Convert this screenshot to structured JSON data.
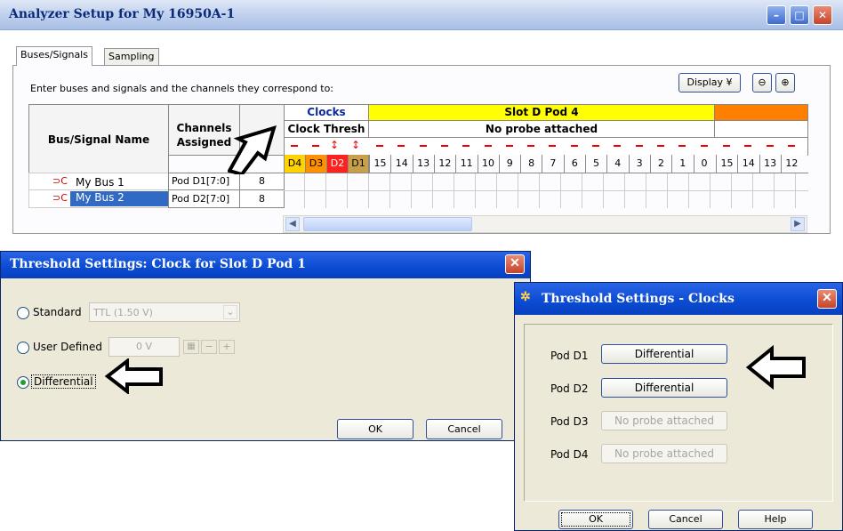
{
  "main_window": {
    "title": "Analyzer Setup for My 16950A-1",
    "tabs": [
      {
        "label": "Buses/Signals",
        "active": true
      },
      {
        "label": "Sampling",
        "active": false
      }
    ],
    "instruction": "Enter buses and signals and the channels they correspond to:",
    "display_button": "Display",
    "zoom_out_icon": "zoom-out-icon",
    "zoom_in_icon": "zoom-in-icon",
    "headers": {
      "bus_signal_name": "Bus/Signal Name",
      "channels_assigned": "Channels Assigned",
      "clocks": "Clocks",
      "clock_thresh": "Clock Thresh",
      "slot_pod": "Slot D Pod 4",
      "no_probe": "No probe attached"
    },
    "clock_channels": [
      "D4",
      "D3",
      "D2",
      "D1"
    ],
    "pod4_channels": [
      "15",
      "14",
      "13",
      "12",
      "11",
      "10",
      "9",
      "8",
      "7",
      "6",
      "5",
      "4",
      "3",
      "2",
      "1",
      "0"
    ],
    "next_pod_channels": [
      "15",
      "14",
      "13",
      "12"
    ],
    "rows": [
      {
        "name": "My Bus 1",
        "channels": "Pod D1[7:0]",
        "width": "8"
      },
      {
        "name": "My Bus 2",
        "channels": "Pod D2[7:0]",
        "width": "8"
      }
    ],
    "colors": {
      "clocks_header": "#0b2aa0",
      "slot_yellow": "#ffff00",
      "slot_orange": "#ff7f00",
      "d4": "#ffd200",
      "d3": "#ff9000",
      "d2": "#ff2020",
      "d1": "#c8a04a"
    }
  },
  "threshold_dialog_pod1": {
    "title": "Threshold Settings: Clock for Slot D Pod 1",
    "standard_label": "Standard",
    "standard_value": "TTL (1.50 V)",
    "user_defined_label": "User Defined",
    "user_defined_value": "0 V",
    "differential_label": "Differential",
    "ok_label": "OK",
    "cancel_label": "Cancel"
  },
  "threshold_dialog_clocks": {
    "title": "Threshold Settings - Clocks",
    "pods": [
      {
        "label": "Pod D1",
        "value": "Differential",
        "enabled": true
      },
      {
        "label": "Pod D2",
        "value": "Differential",
        "enabled": true
      },
      {
        "label": "Pod D3",
        "value": "No probe attached",
        "enabled": false
      },
      {
        "label": "Pod D4",
        "value": "No probe attached",
        "enabled": false
      }
    ],
    "ok_label": "OK",
    "cancel_label": "Cancel",
    "help_label": "Help"
  }
}
